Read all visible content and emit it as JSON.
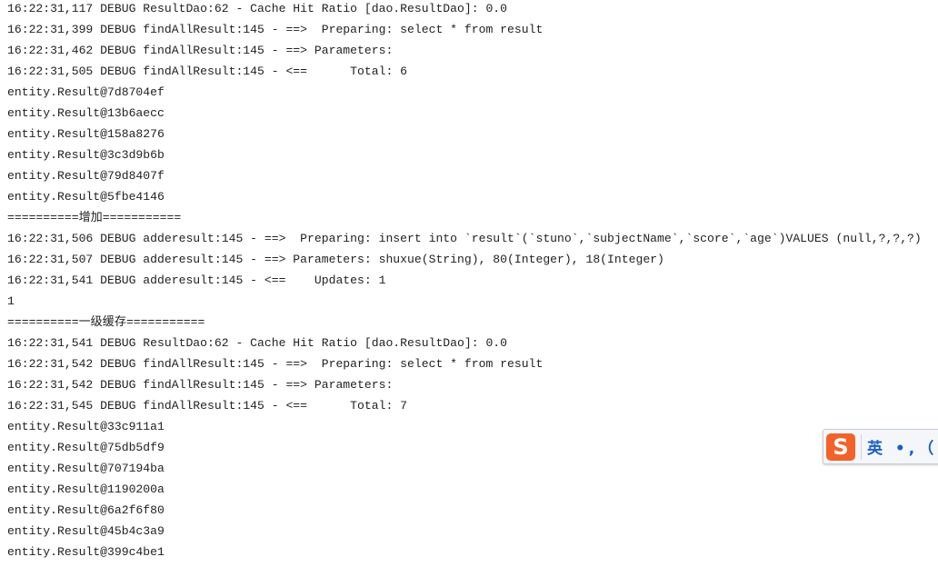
{
  "console": {
    "lines": [
      "16:22:31,117 DEBUG ResultDao:62 - Cache Hit Ratio [dao.ResultDao]: 0.0",
      "16:22:31,399 DEBUG findAllResult:145 - ==>  Preparing: select * from result",
      "16:22:31,462 DEBUG findAllResult:145 - ==> Parameters: ",
      "16:22:31,505 DEBUG findAllResult:145 - <==      Total: 6",
      "entity.Result@7d8704ef",
      "entity.Result@13b6aecc",
      "entity.Result@158a8276",
      "entity.Result@3c3d9b6b",
      "entity.Result@79d8407f",
      "entity.Result@5fbe4146",
      "==========增加===========",
      "16:22:31,506 DEBUG adderesult:145 - ==>  Preparing: insert into `result`(`stuno`,`subjectName`,`score`,`age`)VALUES (null,?,?,?)",
      "16:22:31,507 DEBUG adderesult:145 - ==> Parameters: shuxue(String), 80(Integer), 18(Integer)",
      "16:22:31,541 DEBUG adderesult:145 - <==    Updates: 1",
      "1",
      "==========一级缓存===========",
      "16:22:31,541 DEBUG ResultDao:62 - Cache Hit Ratio [dao.ResultDao]: 0.0",
      "16:22:31,542 DEBUG findAllResult:145 - ==>  Preparing: select * from result",
      "16:22:31,542 DEBUG findAllResult:145 - ==> Parameters: ",
      "16:22:31,545 DEBUG findAllResult:145 - <==      Total: 7",
      "entity.Result@33c911a1",
      "entity.Result@75db5df9",
      "entity.Result@707194ba",
      "entity.Result@1190200a",
      "entity.Result@6a2f6f80",
      "entity.Result@45b4c3a9",
      "entity.Result@399c4be1"
    ]
  },
  "ime": {
    "logo": "S",
    "mode_text": "英 •,（",
    "icon": "sogou-ime-icon",
    "brand_color": "#f2622a"
  }
}
